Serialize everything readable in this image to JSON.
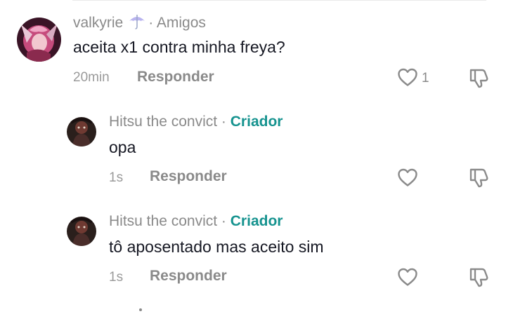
{
  "comments": [
    {
      "author": "valkyrie",
      "separator": "·",
      "tag": "Amigos",
      "text": "aceita x1 contra minha freya?",
      "time": "20min",
      "reply_label": "Responder",
      "likes": "1"
    },
    {
      "author": "Hitsu the convict",
      "separator": "·",
      "tag": "Criador",
      "text": "opa",
      "time": "1s",
      "reply_label": "Responder"
    },
    {
      "author": "Hitsu the convict",
      "separator": "·",
      "tag": "Criador",
      "text": "tô aposentado mas aceito sim",
      "time": "1s",
      "reply_label": "Responder"
    }
  ],
  "icons": {
    "name_badge": "umbrella-icon",
    "like": "heart-icon",
    "dislike": "thumbs-down-icon"
  },
  "colors": {
    "creator_accent": "#16938f",
    "text_primary": "#161823",
    "text_secondary": "#8a8a8a"
  }
}
